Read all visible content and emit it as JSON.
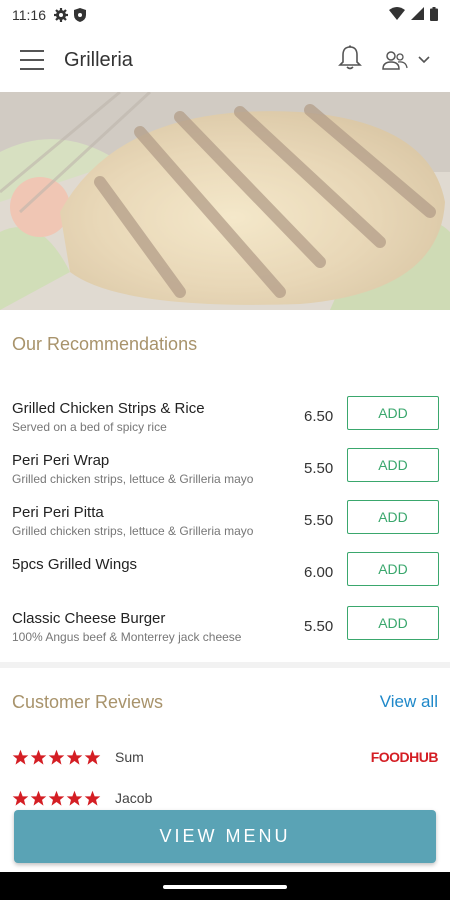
{
  "status": {
    "time": "11:16"
  },
  "app": {
    "title": "Grilleria"
  },
  "recommendations": {
    "title": "Our Recommendations",
    "add_label": "ADD",
    "items": [
      {
        "name": "Grilled Chicken Strips & Rice",
        "desc": "Served on a bed of spicy rice",
        "price": "6.50"
      },
      {
        "name": "Peri Peri Wrap",
        "desc": "Grilled chicken strips, lettuce & Grilleria mayo",
        "price": "5.50"
      },
      {
        "name": "Peri Peri Pitta",
        "desc": "Grilled chicken strips, lettuce & Grilleria mayo",
        "price": "5.50"
      },
      {
        "name": "5pcs Grilled Wings",
        "desc": "",
        "price": "6.00"
      },
      {
        "name": "Classic Cheese Burger",
        "desc": "100% Angus beef & Monterrey jack cheese",
        "price": "5.50"
      }
    ]
  },
  "reviews": {
    "title": "Customer Reviews",
    "view_all": "View all",
    "items": [
      {
        "name": "Sum",
        "source": "FOODHUB",
        "rating": 5
      },
      {
        "name": "Jacob",
        "source": "",
        "rating": 5
      }
    ]
  },
  "cta": {
    "label": "VIEW MENU"
  },
  "colors": {
    "accent": "#a8936b",
    "button": "#5aa3b5",
    "add": "#3aa76d",
    "star": "#d41e24",
    "link": "#1e88c9"
  }
}
